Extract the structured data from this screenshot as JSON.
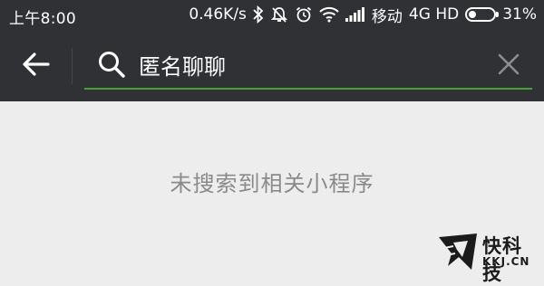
{
  "status_bar": {
    "time": "上午8:00",
    "speed": "0.46K/s",
    "carrier": "移动",
    "network": "4G HD",
    "battery_pct": "31%",
    "battery_level": 0.31,
    "icons": [
      "bluetooth-icon",
      "mute-icon",
      "alarm-icon",
      "wifi-icon",
      "signal-icon",
      "battery-icon"
    ]
  },
  "search": {
    "query": "匿名聊聊",
    "back_icon": "arrow-left-icon",
    "search_icon": "magnifier-icon",
    "clear_icon": "close-icon",
    "underline_color": "#47a03a"
  },
  "results": {
    "empty_message": "未搜索到相关小程序"
  },
  "watermark": {
    "brand": "快科技",
    "domain": "KKJ.CN"
  },
  "colors": {
    "header_bg": "#303135",
    "page_bg": "#ededed",
    "empty_text": "#8a8a8a"
  }
}
